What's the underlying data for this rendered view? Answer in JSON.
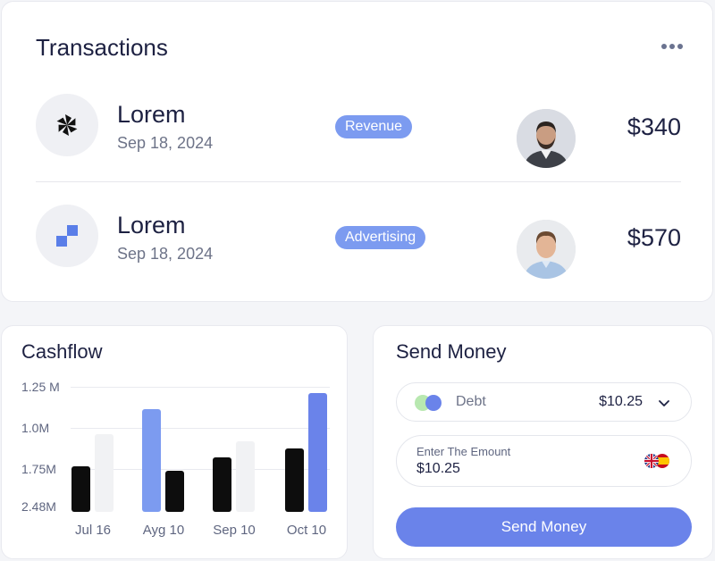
{
  "transactions": {
    "title": "Transactions",
    "more_icon": "more-horizontal-icon",
    "items": [
      {
        "name": "Lorem",
        "date": "Sep 18, 2024",
        "category": "Revenue",
        "amount": "$340",
        "icon": "pinwheel-icon"
      },
      {
        "name": "Lorem",
        "date": "Sep 18, 2024",
        "category": "Advertising",
        "amount": "$570",
        "icon": "steps-icon"
      }
    ]
  },
  "cashflow": {
    "title": "Cashflow",
    "chart_data": {
      "type": "bar",
      "categories": [
        "Jul 16",
        "Ayg 10",
        "Sep 10",
        "Oct 10"
      ],
      "y_tick_labels": [
        "1.25 M",
        "1.0M",
        "1.75M",
        "2.48M"
      ],
      "series": [
        {
          "values": [
            2,
            1.8,
            2.4,
            2.8
          ],
          "color": "#0d0d0d"
        },
        {
          "values": [
            3.4,
            4.5,
            3.1,
            5.2
          ],
          "color": "#7c9bf0"
        }
      ],
      "series_colors_note": "second bar colour per category: light grey, blue, light grey, blue",
      "bar2_colors": [
        "#f1f2f4",
        "#7c9bf0",
        "#f1f2f4",
        "#6a83ea"
      ],
      "grid": true
    }
  },
  "send_money": {
    "title": "Send Money",
    "debt_label": "Debt",
    "debt_value": "$10.25",
    "amount_label": "Enter The Emount",
    "amount_value": "$10.25",
    "button_label": "Send Money",
    "colors": {
      "accent": "#6a83ea"
    }
  }
}
